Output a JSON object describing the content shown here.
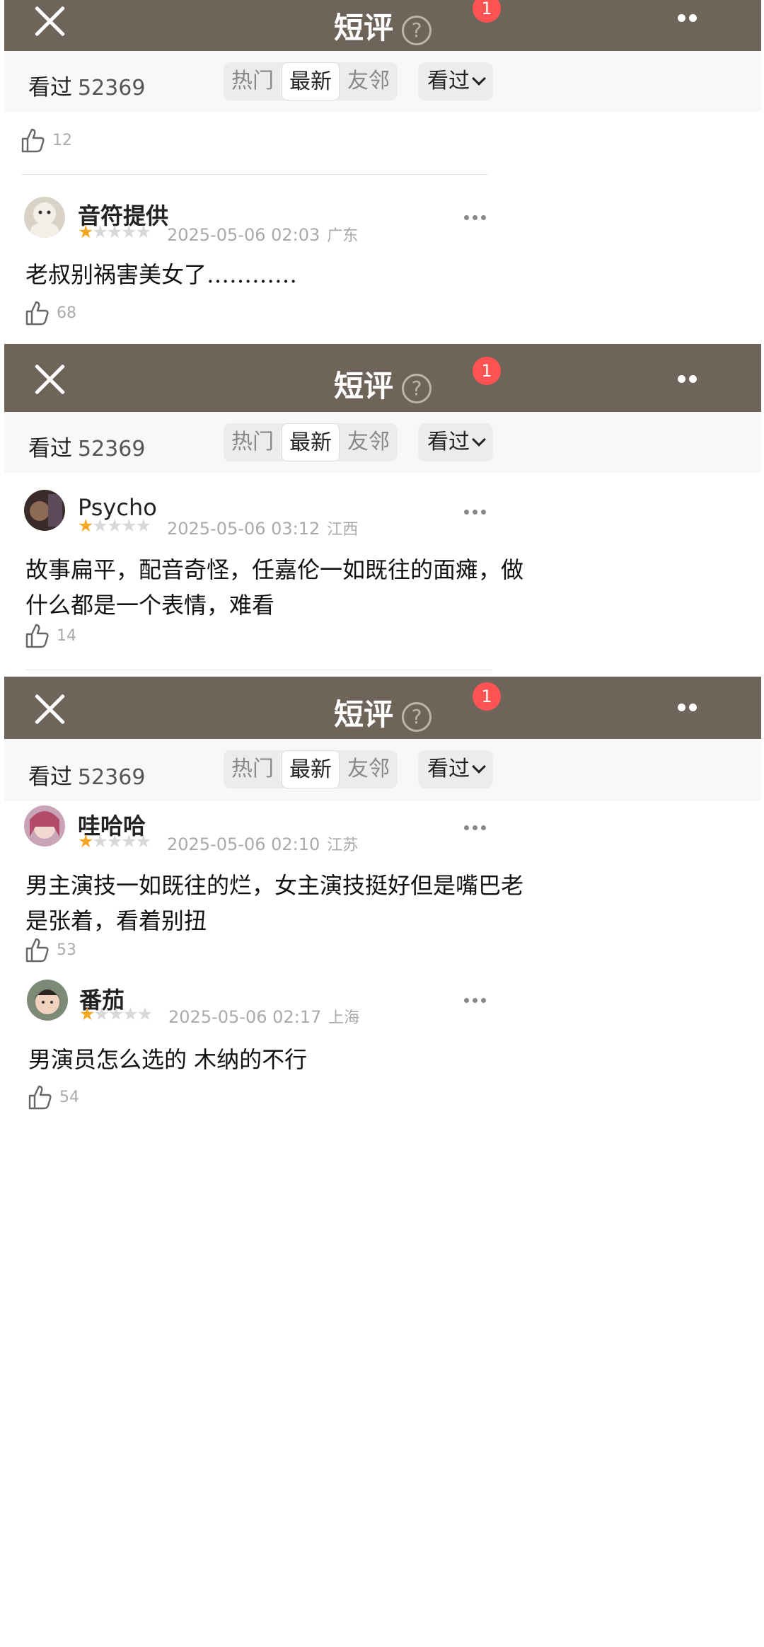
{
  "header": {
    "title": "短评",
    "help_icon": "?",
    "badge": "1"
  },
  "filter": {
    "seen_label": "看过",
    "seen_count": "52369",
    "tabs": [
      "热门",
      "最新",
      "友邻"
    ],
    "active_tab": "最新",
    "sort_label": "看过"
  },
  "segment1": {
    "prev_like": "12",
    "comment": {
      "user": "音符提供",
      "rating": 1,
      "date": "2025-05-06 02:03",
      "location": "广东",
      "text": "老叔别祸害美女了…………",
      "likes": "68"
    }
  },
  "segment2": {
    "comment": {
      "user": "Psycho",
      "rating": 1,
      "date": "2025-05-06 03:12",
      "location": "江西",
      "text_line1": "故事扁平，配音奇怪，任嘉伦一如既往的面瘫，做",
      "text_line2": "什么都是一个表情，难看",
      "likes": "14"
    }
  },
  "segment3": {
    "comment": {
      "user": "哇哈哈",
      "rating": 1,
      "date": "2025-05-06 02:10",
      "location": "江苏",
      "text_line1": "男主演技一如既往的烂，女主演技挺好但是嘴巴老",
      "text_line2": "是张着，看着别扭",
      "likes": "53"
    }
  },
  "segment4": {
    "comment": {
      "user": "番茄",
      "rating": 1,
      "date": "2025-05-06 02:17",
      "location": "上海",
      "text": "男演员怎么选的 木纳的不行",
      "likes": "54"
    }
  },
  "colors": {
    "header_bg": "#6f645a",
    "star_on": "#f5a623",
    "badge": "#ff5252"
  }
}
